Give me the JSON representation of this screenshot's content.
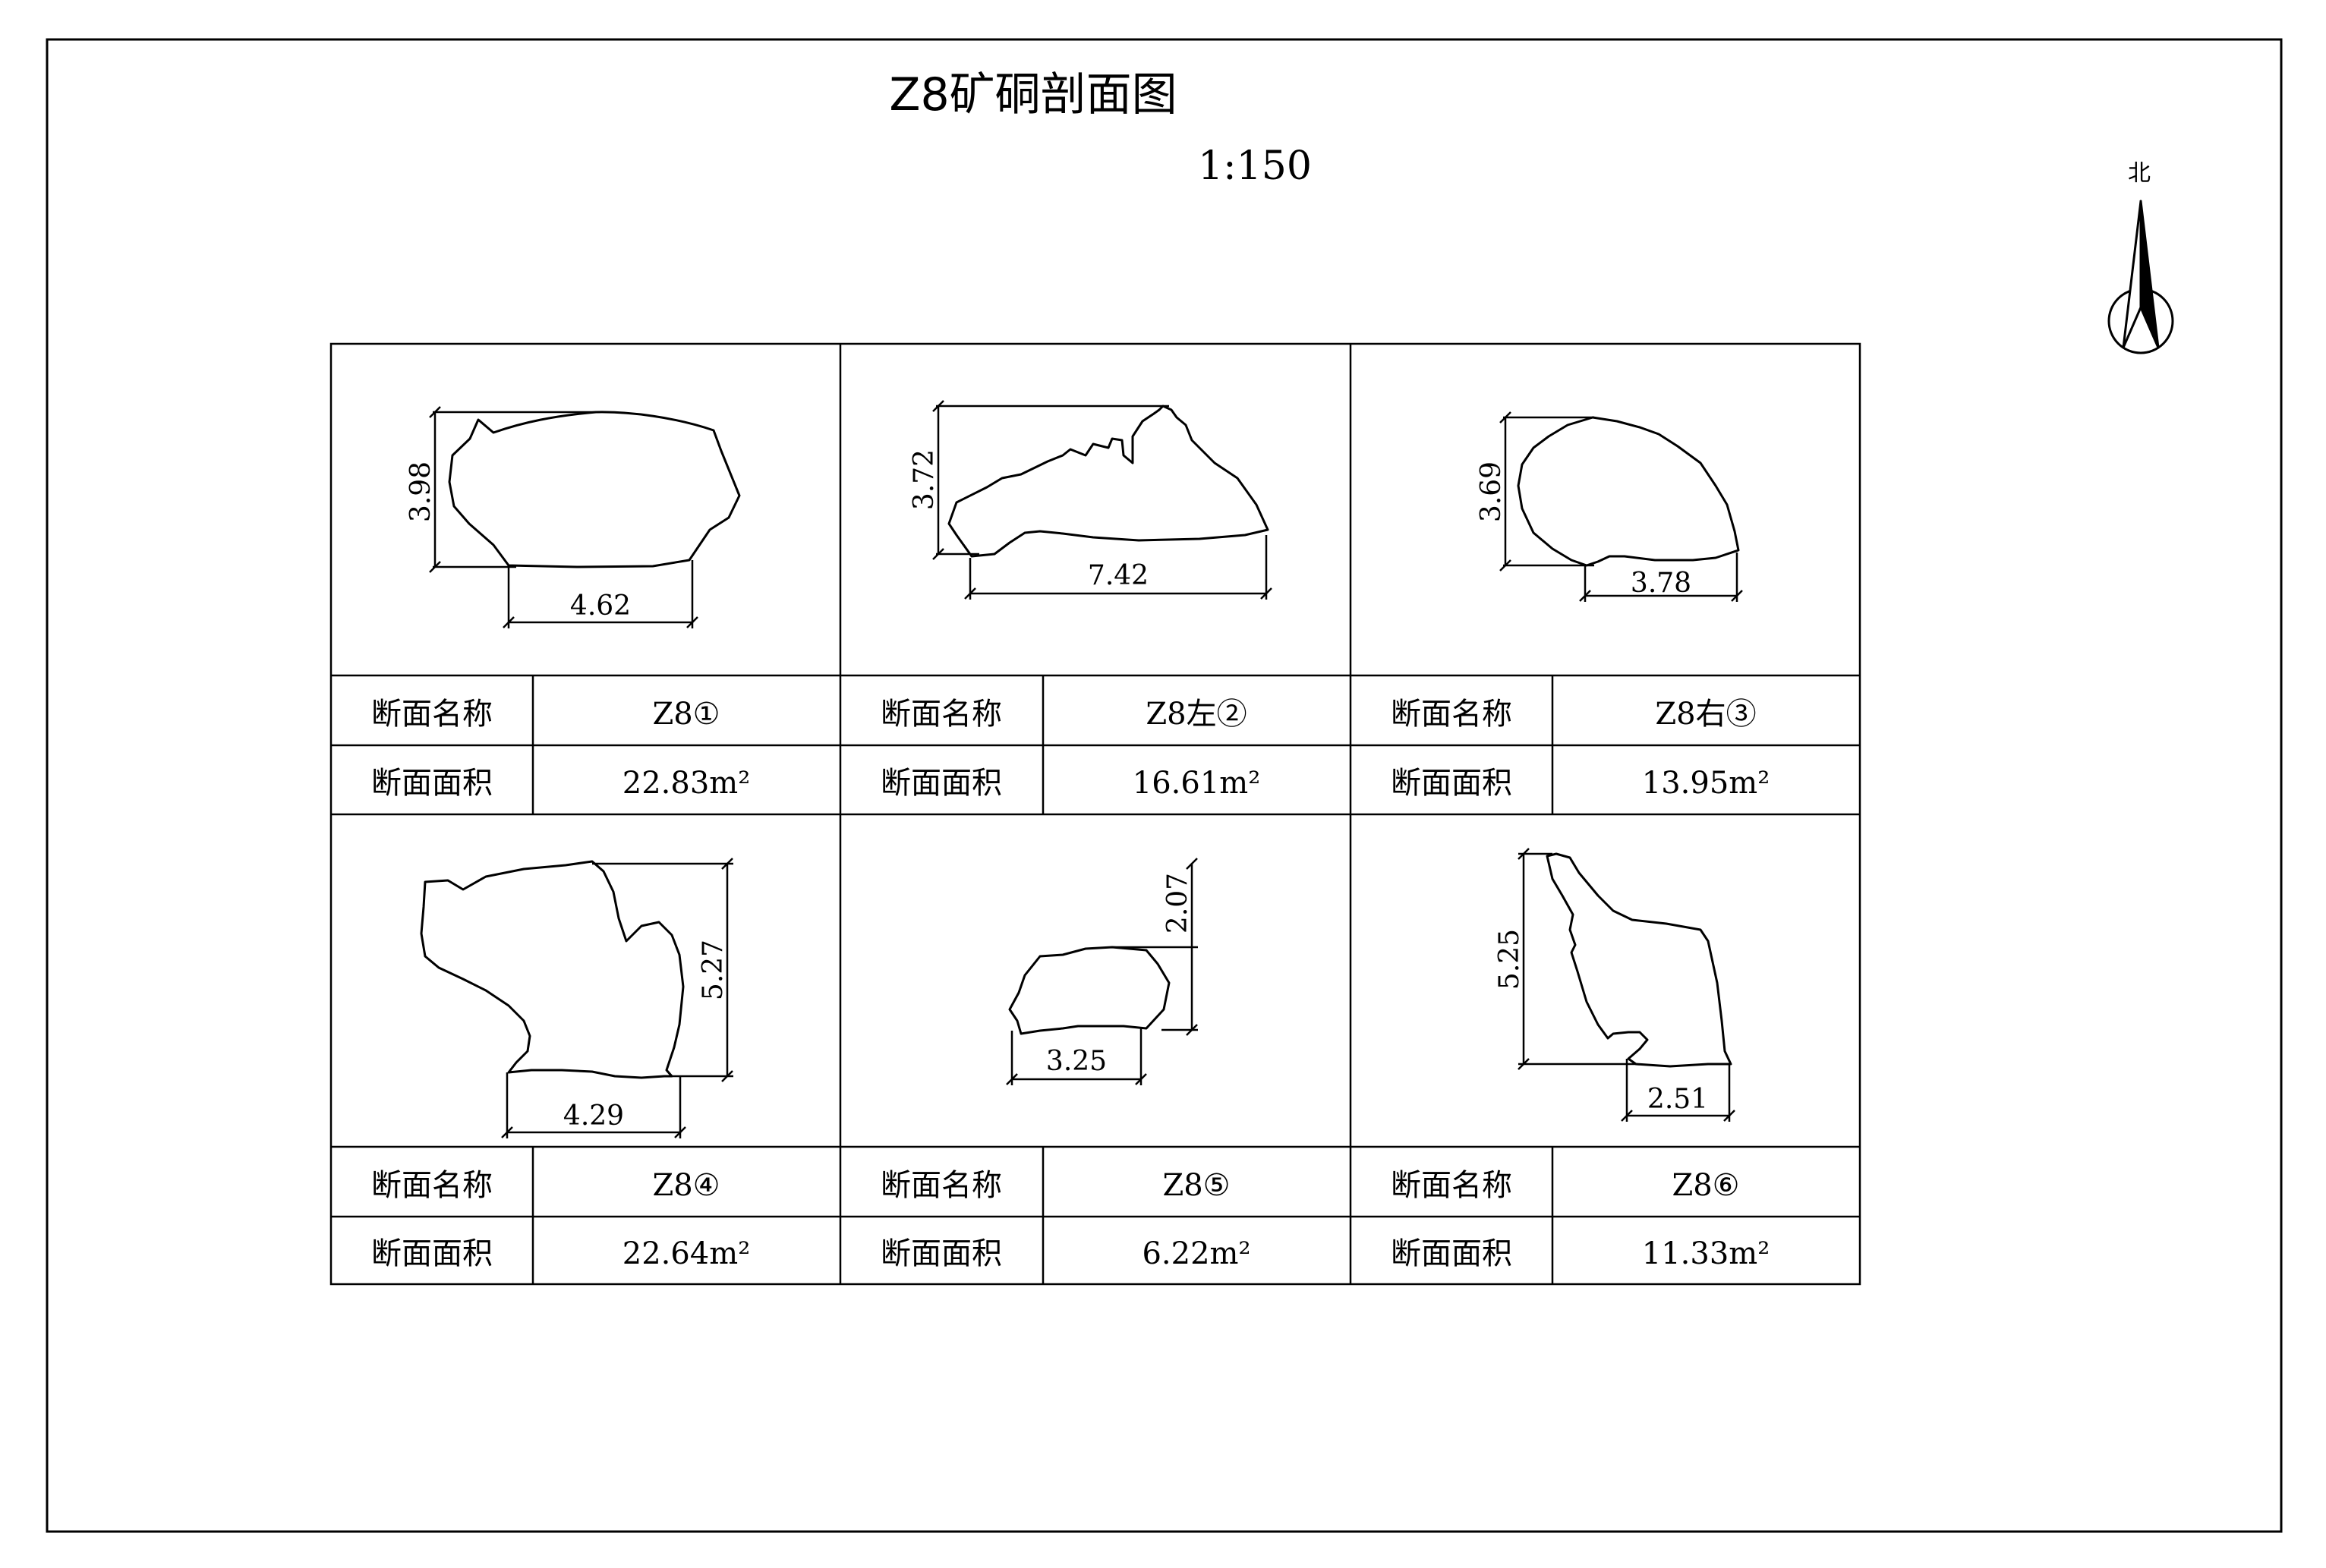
{
  "title": "Z8矿硐剖面图",
  "scale": "1:150",
  "north_label": "北",
  "row_labels": {
    "name": "断面名称",
    "area": "断面面积"
  },
  "sections": [
    {
      "name": "Z8①",
      "area": "22.83m²",
      "height": "3.98",
      "width": "4.62"
    },
    {
      "name": "Z8左②",
      "area": "16.61m²",
      "height": "3.72",
      "width": "7.42"
    },
    {
      "name": "Z8右③",
      "area": "13.95m²",
      "height": "3.69",
      "width": "3.78"
    },
    {
      "name": "Z8④",
      "area": "22.64m²",
      "height": "5.27",
      "width": "4.29"
    },
    {
      "name": "Z8⑤",
      "area": "6.22m²",
      "height": "2.07",
      "width": "3.25"
    },
    {
      "name": "Z8⑥",
      "area": "11.33m²",
      "height": "5.25",
      "width": "2.51"
    }
  ]
}
